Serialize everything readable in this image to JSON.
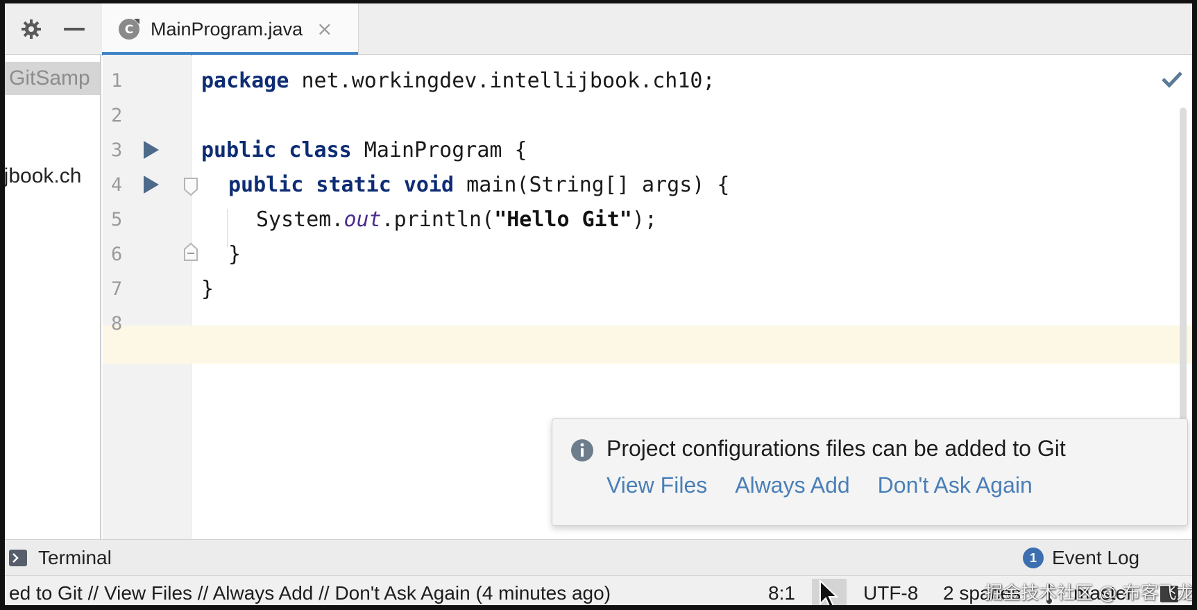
{
  "editor_tab": {
    "filename": "MainProgram.java"
  },
  "project_panel": {
    "root_label": "GitSamp",
    "package_label": "ijbook.ch"
  },
  "code_lines": [
    {
      "num": "1",
      "run": false,
      "fold": ""
    },
    {
      "num": "2",
      "run": false,
      "fold": ""
    },
    {
      "num": "3",
      "run": true,
      "fold": ""
    },
    {
      "num": "4",
      "run": true,
      "fold": "open"
    },
    {
      "num": "5",
      "run": false,
      "fold": ""
    },
    {
      "num": "6",
      "run": false,
      "fold": "close"
    },
    {
      "num": "7",
      "run": false,
      "fold": ""
    },
    {
      "num": "8",
      "run": false,
      "fold": ""
    }
  ],
  "code": {
    "l1": {
      "kw": "package",
      "rest": " net.workingdev.intellijbook.ch10;"
    },
    "l3": {
      "kw": "public class",
      "rest": " MainProgram {"
    },
    "l4": {
      "kw": "public static void",
      "rest": " main(String[] args) {"
    },
    "l5": {
      "pre": "System.",
      "field": "out",
      "mid": ".println(",
      "str": "\"Hello Git\"",
      "end": ");"
    },
    "l6": "}",
    "l7": "}"
  },
  "notification": {
    "message": "Project configurations files can be added to Git",
    "actions": [
      "View Files",
      "Always Add",
      "Don't Ask Again"
    ]
  },
  "tool_windows": {
    "terminal": "Terminal",
    "event_log": "Event Log",
    "event_count": "1"
  },
  "status_bar": {
    "message": "ed to Git // View Files // Always Add // Don't Ask Again (4 minutes ago)",
    "position": "8:1",
    "encoding": "UTF-8",
    "indent": "2 spaces",
    "branch": "master",
    "watermark": "掘金技术社区 @ 布客飞龙"
  },
  "colors": {
    "accent": "#4083c9",
    "link": "#4a7fb6",
    "keyword": "#0d2c73",
    "current_line": "#fdf8e6"
  }
}
